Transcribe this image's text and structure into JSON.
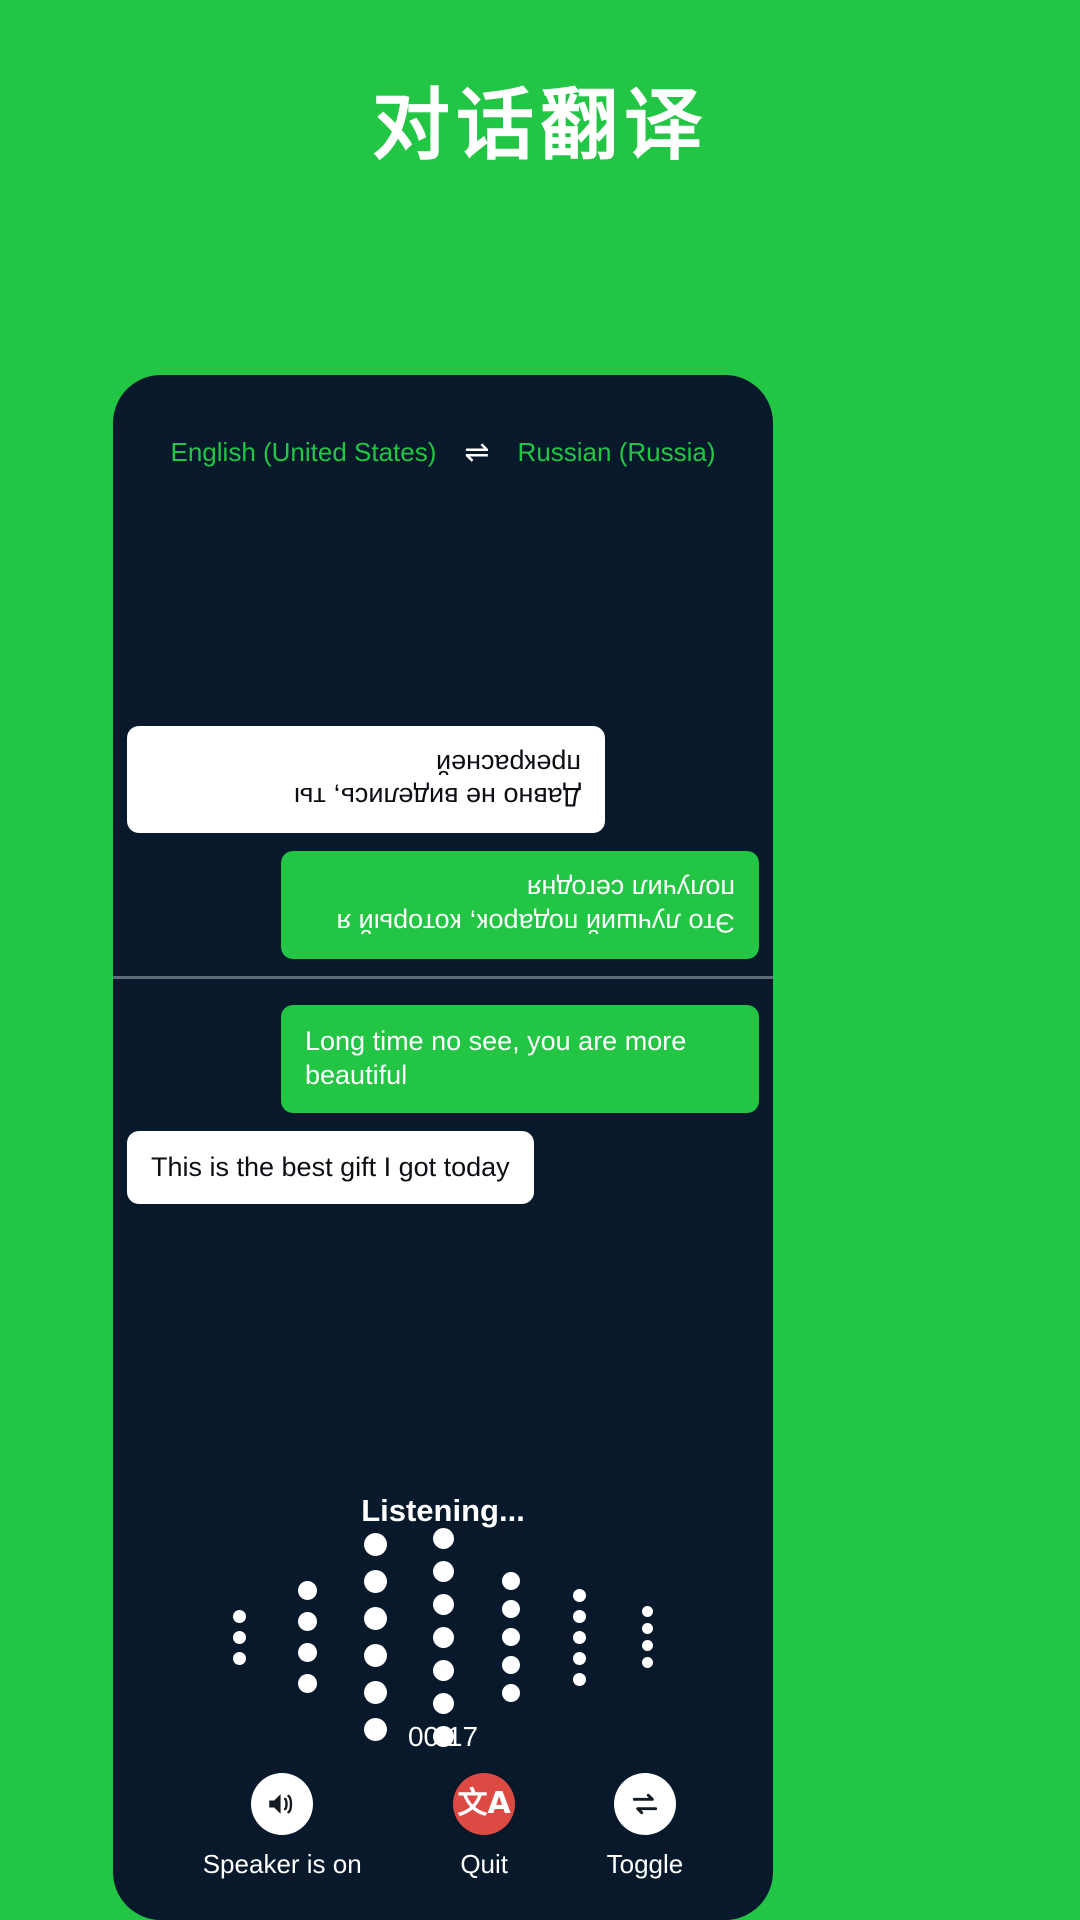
{
  "header": {
    "title": "对话翻译"
  },
  "colors": {
    "brand_green": "#22c644",
    "screen_dark": "#07192b",
    "bubble_white": "#ffffff",
    "quit_red": "#dd4a43",
    "divider": "#5e6b78"
  },
  "language_bar": {
    "source_language": "English (United States)",
    "swap_icon": "⇌",
    "target_language": "Russian (Russia)"
  },
  "conversation": {
    "remote_pane": {
      "rotated": true,
      "messages": [
        {
          "text": "Это лучший подарок, который я получил сегодня",
          "style": "green",
          "align": "left"
        },
        {
          "text": "Давно не виделись, ты прекрасней",
          "style": "white",
          "align": "right"
        }
      ]
    },
    "local_pane": {
      "rotated": false,
      "messages": [
        {
          "text": "Long time no see, you are more beautiful",
          "style": "green",
          "align": "right"
        },
        {
          "text": "This is the best gift I got today",
          "style": "white",
          "align": "left"
        }
      ]
    }
  },
  "listening": {
    "status_label": "Listening...",
    "timer": "00:17",
    "waveform": {
      "columns": [
        {
          "dots": 3,
          "size": 13
        },
        {
          "dots": 4,
          "size": 19
        },
        {
          "dots": 6,
          "size": 23
        },
        {
          "dots": 7,
          "size": 21
        },
        {
          "dots": 5,
          "size": 18
        },
        {
          "dots": 5,
          "size": 13
        },
        {
          "dots": 4,
          "size": 11
        }
      ]
    }
  },
  "controls": [
    {
      "label": "Speaker is on",
      "icon": "speaker-on-icon",
      "circle": "white"
    },
    {
      "label": "Quit",
      "icon": "translate-icon",
      "circle": "red"
    },
    {
      "label": "Toggle",
      "icon": "swap-arrows-icon",
      "circle": "white"
    }
  ]
}
